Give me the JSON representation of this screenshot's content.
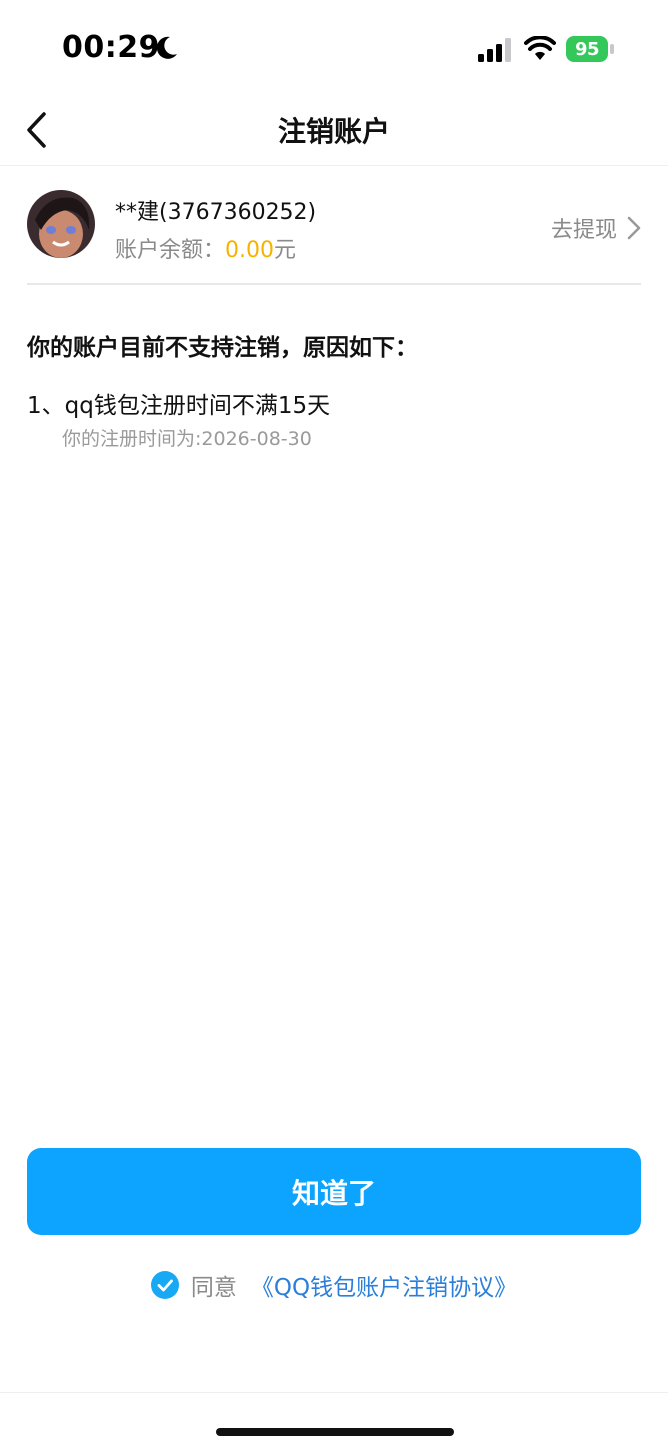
{
  "status_bar": {
    "time": "00:29",
    "battery": "95",
    "icons": [
      "moon-icon",
      "signal-icon",
      "wifi-icon",
      "battery-icon"
    ],
    "battery_color": "#34c759"
  },
  "nav": {
    "title": "注销账户",
    "back_icon": "chevron-left-icon"
  },
  "account": {
    "name": "**建(3767360252)",
    "balance_label": "账户余额：",
    "balance_value": "0.00",
    "balance_unit": "元",
    "withdraw_label": "去提现",
    "amount_color": "#f5b300"
  },
  "notice": {
    "title": "你的账户目前不支持注销，原因如下：",
    "reasons": [
      {
        "text": "1、qq钱包注册时间不满15天",
        "detail": "你的注册时间为:2026-08-30"
      }
    ]
  },
  "actions": {
    "ok_label": "知道了",
    "button_color": "#0da4ff",
    "agree_label": "同意",
    "agreement_link": "《QQ钱包账户注销协议》",
    "agree_checked": true
  }
}
